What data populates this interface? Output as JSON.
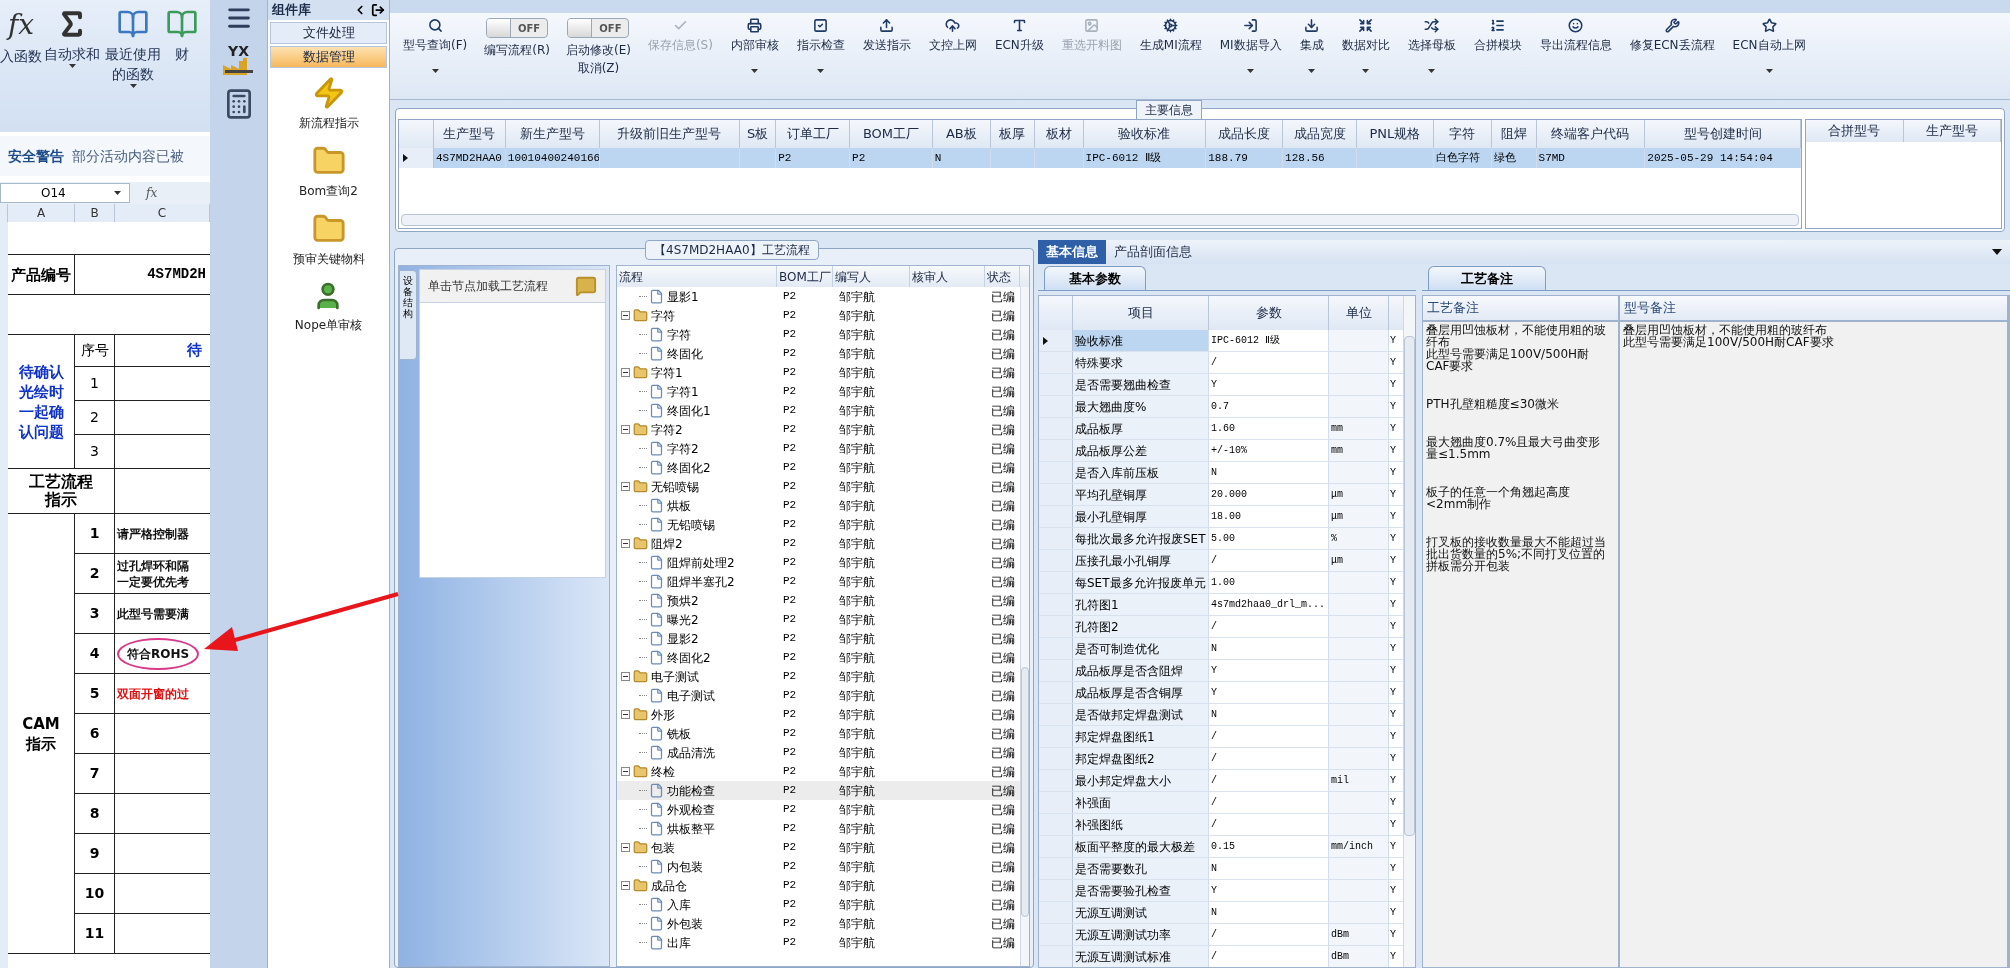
{
  "excel": {
    "ribbon": [
      {
        "label": "入函数",
        "glyph": "fx",
        "dropdown": false
      },
      {
        "label": "自动求和",
        "dropdown": true
      },
      {
        "label": "最近使用的函数",
        "dropdown": true
      },
      {
        "label": "财",
        "dropdown": false
      }
    ],
    "security_warning": {
      "title": "安全警告",
      "message": "部分活动内容已被"
    },
    "formula_bar": {
      "name_box": "O14",
      "glyph": "fx"
    },
    "columns": [
      "A",
      "B",
      "C"
    ],
    "product": {
      "label": "产品编号",
      "value": "4S7MD2H"
    },
    "confirm": {
      "label": "待确认光绘时一起确认问题",
      "index_header": "序号",
      "text_header": "待",
      "rows": [
        "1",
        "2",
        "3"
      ]
    },
    "process_label": "工艺流程指示",
    "cam": {
      "label": "CAM指示",
      "rows": [
        {
          "index": "1",
          "text": "请严格控制器",
          "circled": false,
          "alert": false
        },
        {
          "index": "2",
          "lines": [
            "过孔焊环和隔",
            "一定要优先考"
          ],
          "circled": false,
          "alert": false
        },
        {
          "index": "3",
          "text": "此型号需要满",
          "circled": false,
          "alert": false
        },
        {
          "index": "4",
          "text": "符合ROHS",
          "circled": true,
          "alert": false
        },
        {
          "index": "5",
          "text": "双面开窗的过",
          "circled": false,
          "alert": true
        },
        {
          "index": "6"
        },
        {
          "index": "7"
        },
        {
          "index": "8"
        },
        {
          "index": "9"
        },
        {
          "index": "10"
        },
        {
          "index": "11"
        }
      ]
    }
  },
  "icon_strip": {
    "logo_text": "YX"
  },
  "library": {
    "title": "组件库",
    "groups": [
      {
        "label": "文件处理",
        "selected": false
      },
      {
        "label": "数据管理",
        "selected": true
      }
    ],
    "items": [
      {
        "label": "新流程指示",
        "kind": "bolt"
      },
      {
        "label": "Bom查询2",
        "kind": "folder"
      },
      {
        "label": "预审关键物料",
        "kind": "folder"
      },
      {
        "label": "Nope单审核",
        "kind": "person"
      }
    ]
  },
  "toolbar": [
    {
      "kind": "button",
      "label": "型号查询(F)",
      "dropdown": true,
      "disabled": false
    },
    {
      "kind": "toggle",
      "label": "编写流程(R)",
      "toggle_text": "OFF",
      "on": false
    },
    {
      "kind": "toggle",
      "label": "启动修改(E)",
      "sublabel": "取消(Z)",
      "toggle_text": "OFF",
      "on": false
    },
    {
      "kind": "button",
      "label": "保存信息(S)",
      "dropdown": false,
      "disabled": true
    },
    {
      "kind": "button",
      "label": "内部审核",
      "dropdown": true,
      "disabled": false
    },
    {
      "kind": "button",
      "label": "指示检查",
      "dropdown": true,
      "disabled": false
    },
    {
      "kind": "button",
      "label": "发送指示",
      "dropdown": false,
      "disabled": false
    },
    {
      "kind": "button",
      "label": "文控上网",
      "dropdown": false,
      "disabled": false
    },
    {
      "kind": "button",
      "label": "ECN升级",
      "dropdown": false,
      "disabled": false
    },
    {
      "kind": "button",
      "label": "重选开料图",
      "dropdown": false,
      "disabled": true
    },
    {
      "kind": "button",
      "label": "生成MI流程",
      "dropdown": false,
      "disabled": false
    },
    {
      "kind": "button",
      "label": "MI数据导入",
      "dropdown": true,
      "disabled": false
    },
    {
      "kind": "button",
      "label": "集成",
      "dropdown": true,
      "disabled": false
    },
    {
      "kind": "button",
      "label": "数据对比",
      "dropdown": true,
      "disabled": false
    },
    {
      "kind": "button",
      "label": "选择母板",
      "dropdown": true,
      "disabled": false
    },
    {
      "kind": "button",
      "label": "合拼模块",
      "dropdown": false,
      "disabled": false
    },
    {
      "kind": "button",
      "label": "导出流程信息",
      "dropdown": false,
      "disabled": false
    },
    {
      "kind": "button",
      "label": "修复ECN丢流程",
      "dropdown": false,
      "disabled": false
    },
    {
      "kind": "button",
      "label": "ECN自动上网",
      "dropdown": true,
      "disabled": false
    }
  ],
  "main_info": {
    "title": "主要信息",
    "columns": [
      "生产型号",
      "新生产型号",
      "升级前旧生产型号",
      "S板",
      "订单工厂",
      "BOM工厂",
      "AB板",
      "板厚",
      "板材",
      "验收标准",
      "成品长度",
      "成品宽度",
      "PNL规格",
      "字符",
      "阻焊",
      "终端客户代码",
      "型号创建时间"
    ],
    "rows": [
      {
        "selected": true,
        "cells": [
          "4S7MD2HAA0",
          "10010400240166",
          null,
          null,
          "P2",
          "P2",
          "N",
          null,
          null,
          "IPC-6012 Ⅱ级",
          "188.79",
          "128.56",
          null,
          "白色字符",
          "绿色",
          "S7MD",
          "2025-05-29 14:54:04"
        ]
      }
    ],
    "side_columns": [
      "合拼型号",
      "生产型号"
    ]
  },
  "process": {
    "title": "【4S7MD2HAA0】工艺流程",
    "side_tab": "设备结构",
    "hint": "单击节点加载工艺流程",
    "columns": [
      "流程",
      "BOM工厂",
      "编写人",
      "核审人",
      "状态"
    ],
    "tree": [
      {
        "children": [
          {
            "label": "显影1",
            "factory": "P2",
            "author": "邹宇航",
            "status": "已编",
            "selected": false
          }
        ]
      },
      {
        "label": "字符",
        "factory": "P2",
        "author": "邹宇航",
        "status": "已编",
        "expanded": true,
        "selected": false,
        "children": [
          {
            "label": "字符",
            "factory": "P2",
            "author": "邹宇航",
            "status": "已编",
            "selected": false
          },
          {
            "label": "终固化",
            "factory": "P2",
            "author": "邹宇航",
            "status": "已编",
            "selected": false
          }
        ]
      },
      {
        "label": "字符1",
        "factory": "P2",
        "author": "邹宇航",
        "status": "已编",
        "expanded": true,
        "selected": false,
        "children": [
          {
            "label": "字符1",
            "factory": "P2",
            "author": "邹宇航",
            "status": "已编",
            "selected": false
          },
          {
            "label": "终固化1",
            "factory": "P2",
            "author": "邹宇航",
            "status": "已编",
            "selected": false
          }
        ]
      },
      {
        "label": "字符2",
        "factory": "P2",
        "author": "邹宇航",
        "status": "已编",
        "expanded": true,
        "selected": false,
        "children": [
          {
            "label": "字符2",
            "factory": "P2",
            "author": "邹宇航",
            "status": "已编",
            "selected": false
          },
          {
            "label": "终固化2",
            "factory": "P2",
            "author": "邹宇航",
            "status": "已编",
            "selected": false
          }
        ]
      },
      {
        "label": "无铅喷锡",
        "factory": "P2",
        "author": "邹宇航",
        "status": "已编",
        "expanded": true,
        "selected": false,
        "children": [
          {
            "label": "烘板",
            "factory": "P2",
            "author": "邹宇航",
            "status": "已编",
            "selected": false
          },
          {
            "label": "无铅喷锡",
            "factory": "P2",
            "author": "邹宇航",
            "status": "已编",
            "selected": false
          }
        ]
      },
      {
        "label": "阻焊2",
        "factory": "P2",
        "author": "邹宇航",
        "status": "已编",
        "expanded": true,
        "selected": false,
        "children": [
          {
            "label": "阻焊前处理2",
            "factory": "P2",
            "author": "邹宇航",
            "status": "已编",
            "selected": false
          },
          {
            "label": "阻焊半塞孔2",
            "factory": "P2",
            "author": "邹宇航",
            "status": "已编",
            "selected": false
          },
          {
            "label": "预烘2",
            "factory": "P2",
            "author": "邹宇航",
            "status": "已编",
            "selected": false
          },
          {
            "label": "曝光2",
            "factory": "P2",
            "author": "邹宇航",
            "status": "已编",
            "selected": false
          },
          {
            "label": "显影2",
            "factory": "P2",
            "author": "邹宇航",
            "status": "已编",
            "selected": false
          },
          {
            "label": "终固化2",
            "factory": "P2",
            "author": "邹宇航",
            "status": "已编",
            "selected": false
          }
        ]
      },
      {
        "label": "电子测试",
        "factory": "P2",
        "author": "邹宇航",
        "status": "已编",
        "expanded": true,
        "selected": false,
        "children": [
          {
            "label": "电子测试",
            "factory": "P2",
            "author": "邹宇航",
            "status": "已编",
            "selected": false
          }
        ]
      },
      {
        "label": "外形",
        "factory": "P2",
        "author": "邹宇航",
        "status": "已编",
        "expanded": true,
        "selected": false,
        "children": [
          {
            "label": "铣板",
            "factory": "P2",
            "author": "邹宇航",
            "status": "已编",
            "selected": false
          },
          {
            "label": "成品清洗",
            "factory": "P2",
            "author": "邹宇航",
            "status": "已编",
            "selected": false
          }
        ]
      },
      {
        "label": "终检",
        "factory": "P2",
        "author": "邹宇航",
        "status": "已编",
        "expanded": true,
        "selected": false,
        "children": [
          {
            "label": "功能检查",
            "factory": "P2",
            "author": "邹宇航",
            "status": "已编",
            "selected": true
          },
          {
            "label": "外观检查",
            "factory": "P2",
            "author": "邹宇航",
            "status": "已编",
            "selected": false
          },
          {
            "label": "烘板整平",
            "factory": "P2",
            "author": "邹宇航",
            "status": "已编",
            "selected": false
          }
        ]
      },
      {
        "label": "包装",
        "factory": "P2",
        "author": "邹宇航",
        "status": "已编",
        "expanded": true,
        "selected": false,
        "children": [
          {
            "label": "内包装",
            "factory": "P2",
            "author": "邹宇航",
            "status": "已编",
            "selected": false
          }
        ]
      },
      {
        "label": "成品仓",
        "factory": "P2",
        "author": "邹宇航",
        "status": "已编",
        "expanded": true,
        "selected": false,
        "children": [
          {
            "label": "入库",
            "factory": "P2",
            "author": "邹宇航",
            "status": "已编",
            "selected": false
          },
          {
            "label": "外包装",
            "factory": "P2",
            "author": "邹宇航",
            "status": "已编",
            "selected": false
          },
          {
            "label": "出库",
            "factory": "P2",
            "author": "邹宇航",
            "status": "已编",
            "selected": false
          }
        ]
      }
    ]
  },
  "info_tabs": [
    {
      "label": "基本信息",
      "selected": true
    },
    {
      "label": "产品剖面信息",
      "selected": false
    }
  ],
  "params": {
    "tab": "基本参数",
    "columns": [
      "项目",
      "参数",
      "单位"
    ],
    "rows": [
      {
        "item": "验收标准",
        "value": "IPC-6012 Ⅱ级",
        "flag": "Y",
        "selected": true
      },
      {
        "item": "特殊要求",
        "value": "/",
        "flag": "Y",
        "selected": false
      },
      {
        "item": "是否需要翘曲检查",
        "value": "Y",
        "flag": "Y",
        "selected": false
      },
      {
        "item": "最大翘曲度%",
        "value": "0.7",
        "flag": "Y",
        "selected": false
      },
      {
        "item": "成品板厚",
        "value": "1.60",
        "unit": "mm",
        "flag": "Y",
        "selected": false
      },
      {
        "item": "成品板厚公差",
        "value": "+/-10%",
        "unit": "mm",
        "flag": "Y",
        "selected": false
      },
      {
        "item": "是否入库前压板",
        "value": "N",
        "flag": "Y",
        "selected": false
      },
      {
        "item": "平均孔壁铜厚",
        "value": "20.000",
        "unit": "μm",
        "flag": "Y",
        "selected": false
      },
      {
        "item": "最小孔壁铜厚",
        "value": "18.00",
        "unit": "μm",
        "flag": "Y",
        "selected": false
      },
      {
        "item": "每批次最多允许报废SET",
        "value": "5.00",
        "unit": "%",
        "flag": "Y",
        "selected": false
      },
      {
        "item": "压接孔最小孔铜厚",
        "value": "/",
        "unit": "μm",
        "flag": "Y",
        "selected": false
      },
      {
        "item": "每SET最多允许报废单元",
        "value": "1.00",
        "flag": "Y",
        "selected": false
      },
      {
        "item": "孔符图1",
        "value": "4s7md2haa0_drl_m...",
        "flag": "Y",
        "selected": false
      },
      {
        "item": "孔符图2",
        "value": "/",
        "flag": "Y",
        "selected": false
      },
      {
        "item": "是否可制造优化",
        "value": "N",
        "flag": "Y",
        "selected": false
      },
      {
        "item": "成品板厚是否含阻焊",
        "value": "Y",
        "flag": "Y",
        "selected": false
      },
      {
        "item": "成品板厚是否含铜厚",
        "value": "Y",
        "flag": "Y",
        "selected": false
      },
      {
        "item": "是否做邦定焊盘测试",
        "value": "N",
        "flag": "Y",
        "selected": false
      },
      {
        "item": "邦定焊盘图纸1",
        "value": "/",
        "flag": "Y",
        "selected": false
      },
      {
        "item": "邦定焊盘图纸2",
        "value": "/",
        "flag": "Y",
        "selected": false
      },
      {
        "item": "最小邦定焊盘大小",
        "value": "/",
        "unit": "mil",
        "flag": "Y",
        "selected": false
      },
      {
        "item": "补强面",
        "value": "/",
        "flag": "Y",
        "selected": false
      },
      {
        "item": "补强图纸",
        "value": "/",
        "flag": "Y",
        "selected": false
      },
      {
        "item": "板面平整度的最大极差",
        "value": "0.15",
        "unit": "mm/inch",
        "flag": "Y",
        "selected": false
      },
      {
        "item": "是否需要数孔",
        "value": "N",
        "flag": "Y",
        "selected": false
      },
      {
        "item": "是否需要验孔检查",
        "value": "Y",
        "flag": "Y",
        "selected": false
      },
      {
        "item": "无源互调测试",
        "value": "N",
        "flag": "Y",
        "selected": false
      },
      {
        "item": "无源互调测试功率",
        "value": "/",
        "unit": "dBm",
        "flag": "Y",
        "selected": false
      },
      {
        "item": "无源互调测试标准",
        "value": "/",
        "unit": "dBm",
        "flag": "Y",
        "selected": false
      }
    ]
  },
  "remarks": {
    "tab": "工艺备注",
    "columns": [
      {
        "title": "工艺备注",
        "blocks": [
          [
            "叠层用凹蚀板材，不能使用粗的玻纤布",
            "此型号需要满足100V/500H耐CAF要求"
          ],
          [
            "PTH孔壁粗糙度≤30微米"
          ],
          [
            "最大翘曲度0.7%且最大弓曲变形量≤1.5mm"
          ],
          [
            "板子的任意一个角翘起高度<2mm制作"
          ],
          [
            "打叉板的接收数量最大不能超过当批出货数量的5%;不同打叉位置的拼板需分开包装"
          ]
        ]
      },
      {
        "title": "型号备注",
        "blocks": [
          [
            "叠层用凹蚀板材，不能使用粗的玻纤布",
            "此型号需要满足100V/500H耐CAF要求"
          ]
        ]
      }
    ]
  }
}
